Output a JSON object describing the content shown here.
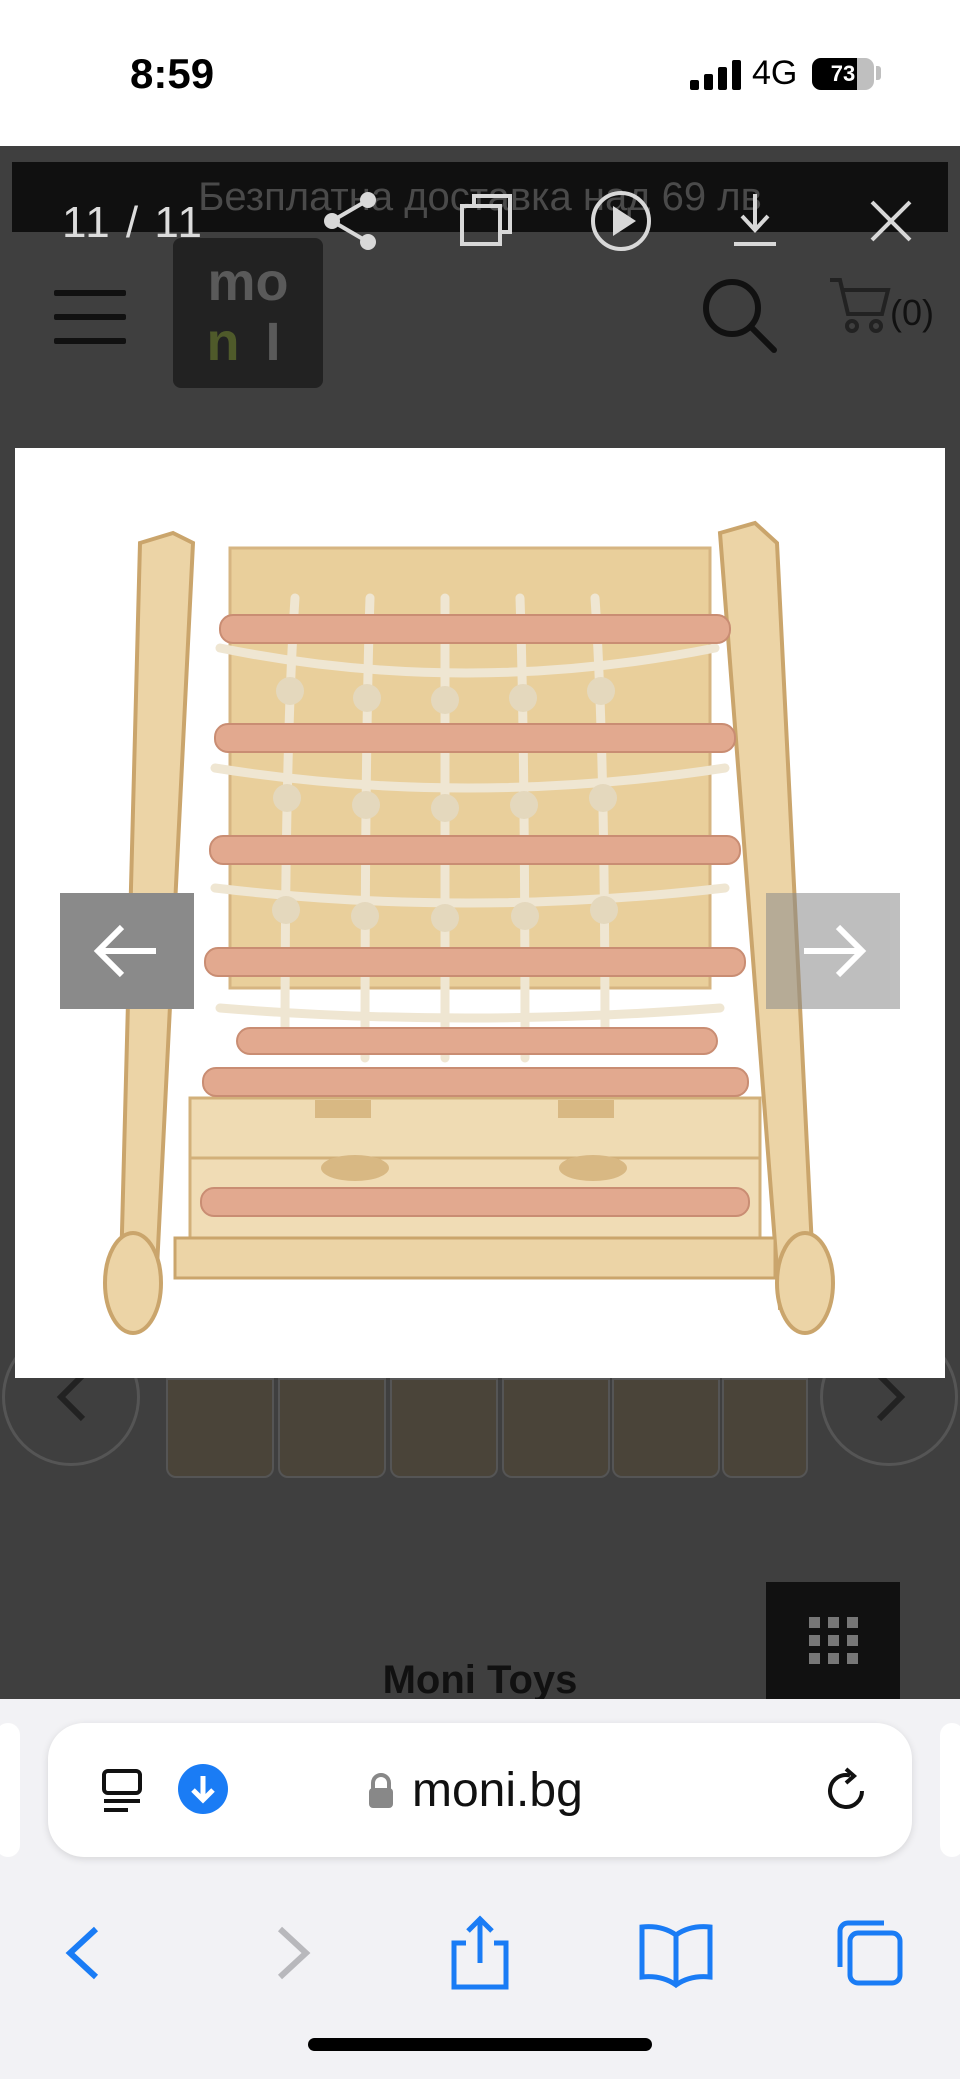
{
  "status_bar": {
    "time": "8:59",
    "network": "4G",
    "battery": "73",
    "battery_level": 0.73
  },
  "site": {
    "promo_text": "Безплатна доставка над 69 лв",
    "logo_text": "MONI",
    "cart_count": "(0)",
    "brand_peek": "Moni Toys"
  },
  "viewer": {
    "counter": "11 / 11",
    "product_alt": "Wooden climbing triangle with rope net"
  },
  "browser": {
    "url": "moni.bg"
  },
  "colors": {
    "accent": "#1a7cf5",
    "overlay": "#3f3f3f",
    "wood": "#e8cfa0",
    "rung": "#e2a98f",
    "rope": "#efe6d2"
  }
}
